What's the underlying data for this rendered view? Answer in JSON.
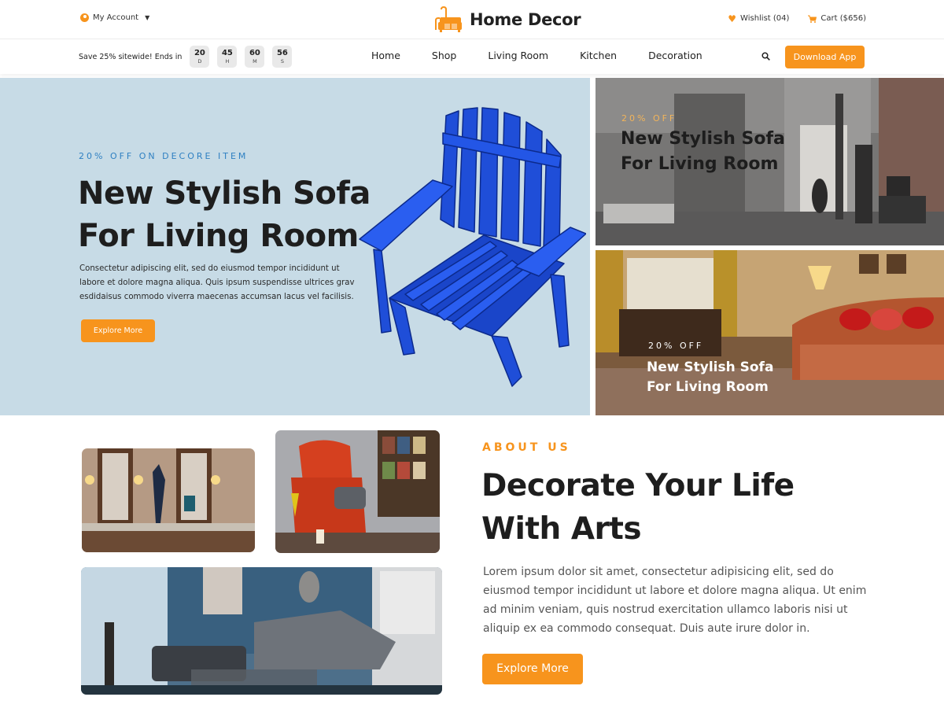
{
  "header": {
    "account_label": "My Account",
    "logo_text": "Home Decor",
    "wishlist_label": "Wishlist (04)",
    "cart_label": "Cart ($656)"
  },
  "nav": {
    "promo_text": "Save 25% sitewide! Ends in",
    "countdown": [
      {
        "value": "20",
        "unit": "D"
      },
      {
        "value": "45",
        "unit": "H"
      },
      {
        "value": "60",
        "unit": "M"
      },
      {
        "value": "56",
        "unit": "S"
      }
    ],
    "menu": [
      "Home",
      "Shop",
      "Living Room",
      "Kitchen",
      "Decoration"
    ],
    "download_label": "Download App",
    "search_icon": "search-icon"
  },
  "hero": {
    "tag": "20% OFF ON DECORE ITEM",
    "title_line1": "New Stylish Sofa",
    "title_line2": "For Living Room",
    "description": "Consectetur adipiscing elit, sed do eiusmod tempor incididunt ut labore et dolore magna aliqua. Quis ipsum suspendisse ultrices grav esdidaisus commodo viverra maecenas accumsan lacus vel facilisis.",
    "button_label": "Explore More"
  },
  "promo_cards": [
    {
      "tag": "20% OFF",
      "title_line1": "New Stylish Sofa",
      "title_line2": "For Living Room"
    },
    {
      "tag": "20% OFF",
      "title_line1": "New Stylish Sofa",
      "title_line2": "For Living Room"
    }
  ],
  "about": {
    "tag": "ABOUT US",
    "title_line1": "Decorate Your Life",
    "title_line2": "With Arts",
    "description": "Lorem ipsum dolor sit amet, consectetur adipisicing elit, sed do eiusmod tempor incididunt ut labore et dolore magna aliqua. Ut enim ad minim veniam, quis nostrud exercitation ullamco laboris nisi ut aliquip ex ea commodo consequat. Duis aute irure dolor in.",
    "button_label": "Explore More"
  },
  "colors": {
    "accent": "#f7941d",
    "hero_bg": "#c7dbe6",
    "tag_blue": "#2f80c2"
  }
}
